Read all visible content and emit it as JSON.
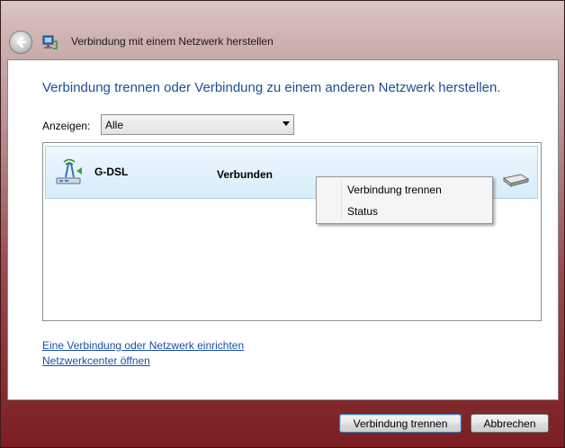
{
  "window": {
    "title": "Verbindung mit einem Netzwerk herstellen"
  },
  "main": {
    "heading": "Verbindung trennen oder Verbindung zu einem anderen Netzwerk herstellen.",
    "show_label": "Anzeigen:",
    "show_value": "Alle"
  },
  "connections": [
    {
      "name": "G-DSL",
      "status": "Verbunden"
    }
  ],
  "context_menu": {
    "items": [
      "Verbindung trennen",
      "Status"
    ]
  },
  "links": {
    "setup": "Eine Verbindung oder Netzwerk einrichten",
    "network_center": "Netzwerkcenter öffnen"
  },
  "buttons": {
    "disconnect": "Verbindung trennen",
    "cancel": "Abbrechen"
  },
  "colors": {
    "heading": "#1e4d96",
    "link": "#1a4fa6",
    "selection": "#d7ecfb"
  }
}
